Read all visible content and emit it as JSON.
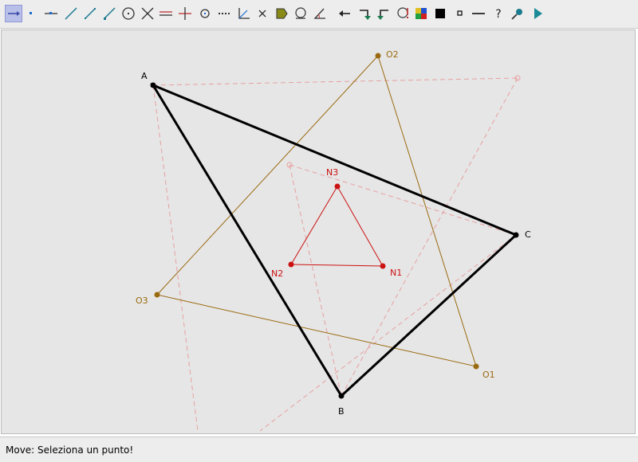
{
  "toolbar": {
    "tools": [
      {
        "name": "move-tool-icon",
        "active": true
      },
      {
        "name": "point-tool-icon"
      },
      {
        "name": "point-on-line-tool-icon"
      },
      {
        "name": "line-tool-icon"
      },
      {
        "name": "segment-tool-icon"
      },
      {
        "name": "ray-tool-icon"
      },
      {
        "name": "circle-tool-icon"
      },
      {
        "name": "intersection-tool-icon"
      },
      {
        "name": "parallel-tool-icon"
      },
      {
        "name": "perpendicular-tool-icon"
      },
      {
        "name": "midpoint-tool-icon"
      },
      {
        "name": "dotted-line-tool-icon"
      },
      {
        "name": "angle-bisector-tool-icon"
      },
      {
        "name": "delete-tool-icon"
      },
      {
        "name": "fill-tool-icon"
      },
      {
        "name": "locus-tool-icon"
      },
      {
        "name": "angle-tool-icon"
      },
      {
        "name": "undo-arrow-icon"
      },
      {
        "name": "redo-turn-icon"
      },
      {
        "name": "back-turn-icon"
      },
      {
        "name": "macro-tool-icon"
      },
      {
        "name": "color-palette-icon"
      },
      {
        "name": "thick-line-icon"
      },
      {
        "name": "thin-point-icon"
      },
      {
        "name": "line-style-icon"
      },
      {
        "name": "help-icon"
      },
      {
        "name": "zoom-tool-icon"
      },
      {
        "name": "play-icon"
      }
    ]
  },
  "figure": {
    "labels": {
      "A": "A",
      "B": "B",
      "C": "C",
      "N1": "N1",
      "N2": "N2",
      "N3": "N3",
      "O1": "O1",
      "O2": "O2",
      "O3": "O3"
    },
    "colors": {
      "triangle": "#000000",
      "napoleon_inner": "#cc1111",
      "napoleon_outer": "#9a6a10",
      "construction": "#e8a0a0",
      "background": "#e6e6e6"
    }
  },
  "status": {
    "text": "Move: Seleziona un punto!"
  }
}
